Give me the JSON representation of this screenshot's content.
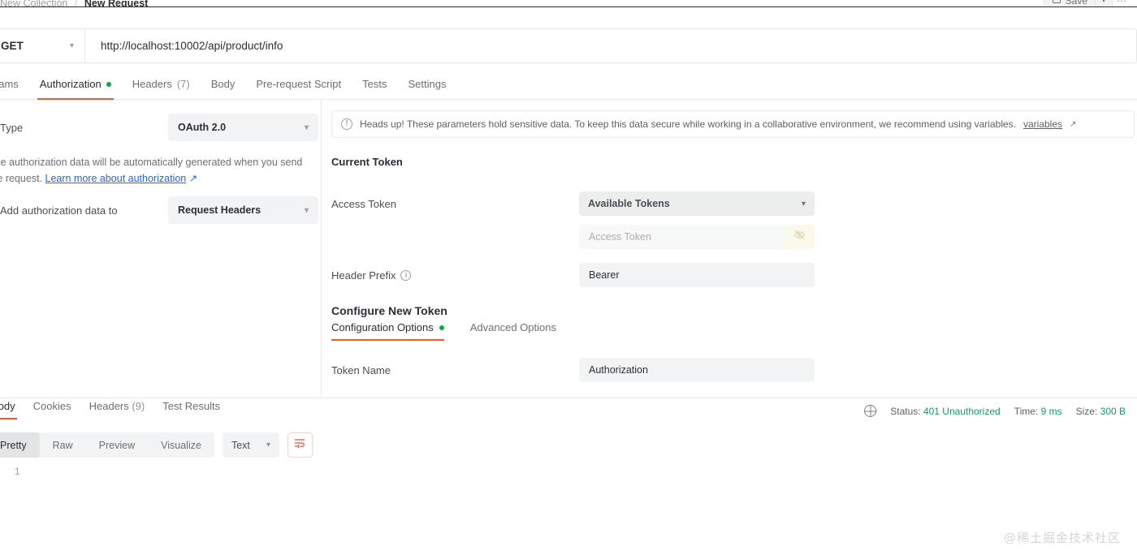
{
  "breadcrumb": {
    "collection": "New Collection",
    "separator": "/",
    "current": "New Request"
  },
  "toolbar": {
    "save_label": "Save",
    "save_icon": "save-disk-icon",
    "save_caret_icon": "chevron-down-icon",
    "more_icon": "ellipsis-icon"
  },
  "request": {
    "method": "GET",
    "method_caret_icon": "chevron-down-icon",
    "url": "http://localhost:10002/api/product/info"
  },
  "request_tabs": [
    {
      "label": "Params",
      "active": false,
      "badge": "",
      "dot": false
    },
    {
      "label": "Authorization",
      "active": true,
      "badge": "",
      "dot": true
    },
    {
      "label": "Headers",
      "active": false,
      "badge": "(7)",
      "dot": false
    },
    {
      "label": "Body",
      "active": false,
      "badge": "",
      "dot": false
    },
    {
      "label": "Pre-request Script",
      "active": false,
      "badge": "",
      "dot": false
    },
    {
      "label": "Tests",
      "active": false,
      "badge": "",
      "dot": false
    },
    {
      "label": "Settings",
      "active": false,
      "badge": "",
      "dot": false
    }
  ],
  "auth_panel": {
    "type_label": "Type",
    "type_value": "OAuth 2.0",
    "type_caret_icon": "chevron-down-icon",
    "help_text_before": "The authorization data will be automatically generated when you send the request. ",
    "help_link": "Learn more about authorization",
    "help_link_icon": "external-link-icon",
    "add_to_label": "Add authorization data to",
    "add_to_value": "Request Headers",
    "add_to_caret_icon": "chevron-down-icon"
  },
  "banner": {
    "icon": "exclamation-circle-icon",
    "text": "Heads up! These parameters hold sensitive data. To keep this data secure while working in a collaborative environment, we recommend using variables. ",
    "link": "variables",
    "link_icon": "external-link-icon"
  },
  "current_token": {
    "heading": "Current Token",
    "access_token_label": "Access Token",
    "available_tokens_value": "Available Tokens",
    "available_tokens_caret_icon": "chevron-down-icon",
    "access_token_placeholder": "Access Token",
    "access_token_value": "",
    "visibility_icon": "eye-off-icon",
    "header_prefix_label": "Header Prefix",
    "header_prefix_info_icon": "info-circle-icon",
    "header_prefix_value": "Bearer"
  },
  "configure_token": {
    "heading": "Configure New Token",
    "tabs": [
      {
        "label": "Configuration Options",
        "active": true,
        "dot": true
      },
      {
        "label": "Advanced Options",
        "active": false,
        "dot": false
      }
    ],
    "token_name_label": "Token Name",
    "token_name_value": "Authorization"
  },
  "response": {
    "tabs": [
      {
        "label": "Body",
        "active": true,
        "badge": ""
      },
      {
        "label": "Cookies",
        "active": false,
        "badge": ""
      },
      {
        "label": "Headers",
        "active": false,
        "badge": "(9)"
      },
      {
        "label": "Test Results",
        "active": false,
        "badge": ""
      }
    ],
    "status_icon": "globe-icon",
    "status_label": "Status:",
    "status_value": "401 Unauthorized",
    "time_label": "Time:",
    "time_value": "9 ms",
    "size_label": "Size:",
    "size_value": "300 B",
    "view_modes": [
      {
        "label": "Pretty",
        "active": true
      },
      {
        "label": "Raw",
        "active": false
      },
      {
        "label": "Preview",
        "active": false
      },
      {
        "label": "Visualize",
        "active": false
      }
    ],
    "format_value": "Text",
    "format_caret_icon": "chevron-down-icon",
    "wrap_icon": "word-wrap-icon",
    "line_numbers": [
      "1"
    ],
    "body_content": ""
  },
  "watermark": {
    "text": "@稀土掘金技术社区"
  },
  "colors": {
    "accent_orange": "#ef5b25",
    "status_green": "#1c9a5e",
    "dot_green": "#16a34a",
    "link_blue": "#2563eb",
    "field_gray": "#f2f3f4"
  }
}
